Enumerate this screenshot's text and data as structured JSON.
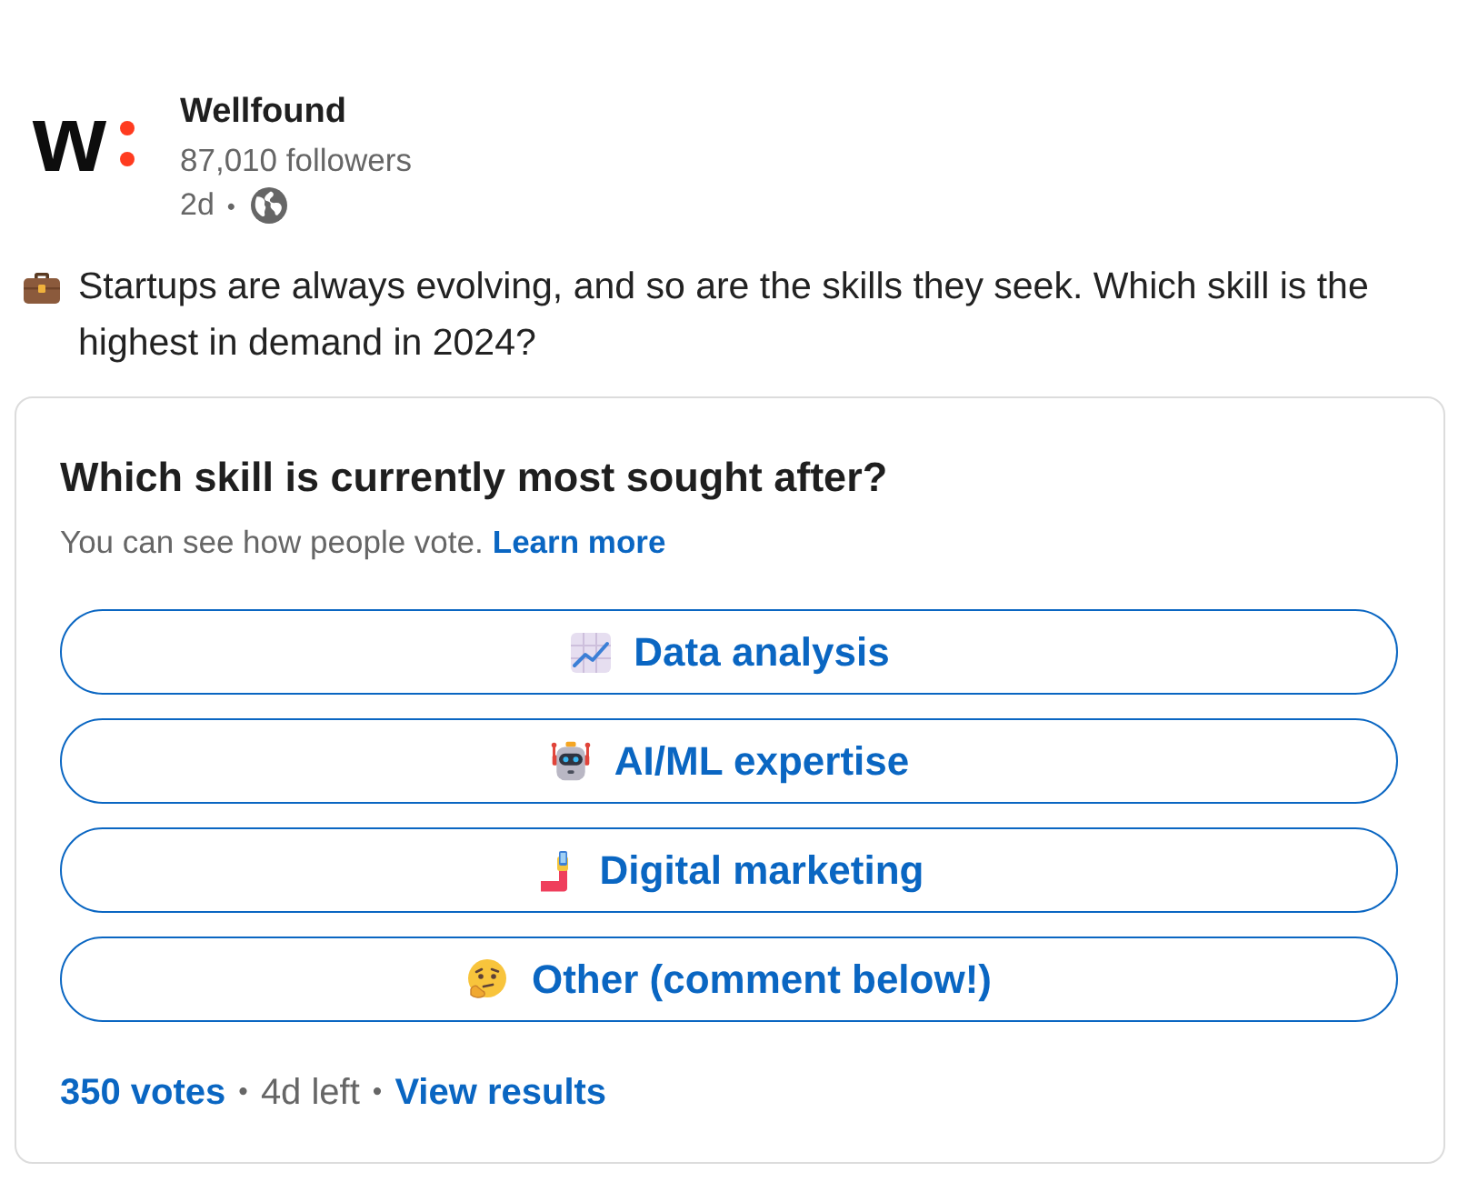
{
  "author": {
    "logo_letter": "w",
    "name": "Wellfound",
    "followers": "87,010 followers",
    "time": "2d",
    "separator": "•"
  },
  "post": {
    "text": "Startups are always evolving, and so are the skills they seek. Which skill is the highest in demand in 2024?"
  },
  "poll": {
    "question": "Which skill is currently most sought after?",
    "note": "You can see how people vote.",
    "note_link": "Learn more",
    "options": [
      {
        "kind": "chart",
        "label": "Data analysis"
      },
      {
        "kind": "robot",
        "label": "AI/ML expertise"
      },
      {
        "kind": "selfie",
        "label": "Digital marketing"
      },
      {
        "kind": "thinking",
        "label": "Other (comment below!)"
      }
    ],
    "footer": {
      "votes": "350 votes",
      "separator": "•",
      "time_left": "4d left",
      "results_link": "View results"
    }
  }
}
